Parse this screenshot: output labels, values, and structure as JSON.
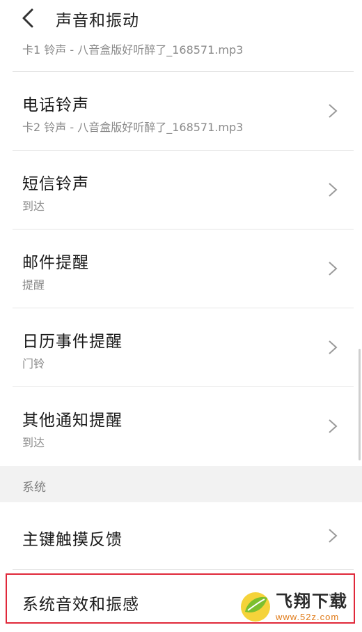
{
  "header": {
    "title": "声音和振动",
    "back_icon": "chevron-left-icon"
  },
  "rows": [
    {
      "id": "sim1",
      "title": "",
      "subtitle": "卡1 铃声 - 八音盒版好听醉了_168571.mp3"
    },
    {
      "id": "phone",
      "title": "电话铃声",
      "subtitle": "卡2 铃声 - 八音盒版好听醉了_168571.mp3"
    },
    {
      "id": "sms",
      "title": "短信铃声",
      "subtitle": "到达"
    },
    {
      "id": "mail",
      "title": "邮件提醒",
      "subtitle": "提醒"
    },
    {
      "id": "calendar",
      "title": "日历事件提醒",
      "subtitle": "门铃"
    },
    {
      "id": "other",
      "title": "其他通知提醒",
      "subtitle": "到达"
    }
  ],
  "section": {
    "label": "系统"
  },
  "system_rows": [
    {
      "id": "home-key",
      "title": "主键触摸反馈"
    },
    {
      "id": "sound-vibration",
      "title": "系统音效和振感"
    }
  ],
  "watermark": {
    "brand": "飞翔下载",
    "url": "www.52z.com"
  },
  "colors": {
    "highlight": "#e0283a",
    "section_bg": "#f2f2f2",
    "watermark_url": "#e07a17"
  }
}
